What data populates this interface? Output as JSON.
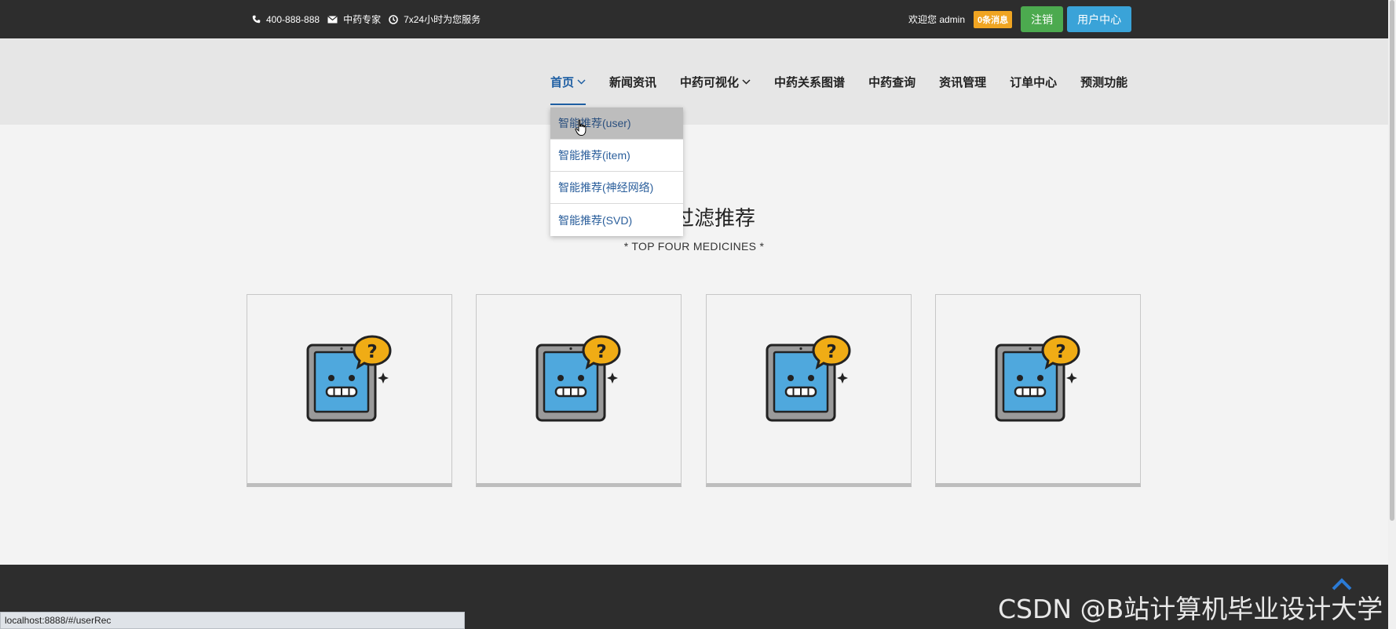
{
  "topbar": {
    "phone": "400-888-888",
    "expert": "中药专家",
    "service": "7x24小时为您服务",
    "welcome": "欢迎您 admin",
    "messages_badge": "0条消息",
    "logout_label": "注销",
    "user_center_label": "用户中心"
  },
  "nav": {
    "items": [
      {
        "label": "首页",
        "has_dropdown": true,
        "active": true
      },
      {
        "label": "新闻资讯"
      },
      {
        "label": "中药可视化",
        "has_dropdown": true
      },
      {
        "label": "中药关系图谱"
      },
      {
        "label": "中药查询"
      },
      {
        "label": "资讯管理"
      },
      {
        "label": "订单中心"
      },
      {
        "label": "预测功能"
      }
    ]
  },
  "dropdown": {
    "items": [
      {
        "label": "智能推荐(user)",
        "hovered": true
      },
      {
        "label": "智能推荐(item)"
      },
      {
        "label": "智能推荐(神经网络)"
      },
      {
        "label": "智能推荐(SVD)"
      }
    ]
  },
  "main": {
    "heading": "协同过滤推荐",
    "subheading": "* TOP FOUR MEDICINES *",
    "cards": [
      {
        "icon": "missing-image-tablet-icon"
      },
      {
        "icon": "missing-image-tablet-icon"
      },
      {
        "icon": "missing-image-tablet-icon"
      },
      {
        "icon": "missing-image-tablet-icon"
      }
    ]
  },
  "statusbar": {
    "url": "localhost:8888/#/userRec"
  },
  "watermark": "CSDN @B站计算机毕业设计大学",
  "colors": {
    "topbar_bg": "#2d2d2d",
    "accent_blue": "#1f5fa3",
    "badge_orange": "#f0a522",
    "logout_green": "#4caa4f",
    "user_center_blue": "#3aa3d8"
  }
}
